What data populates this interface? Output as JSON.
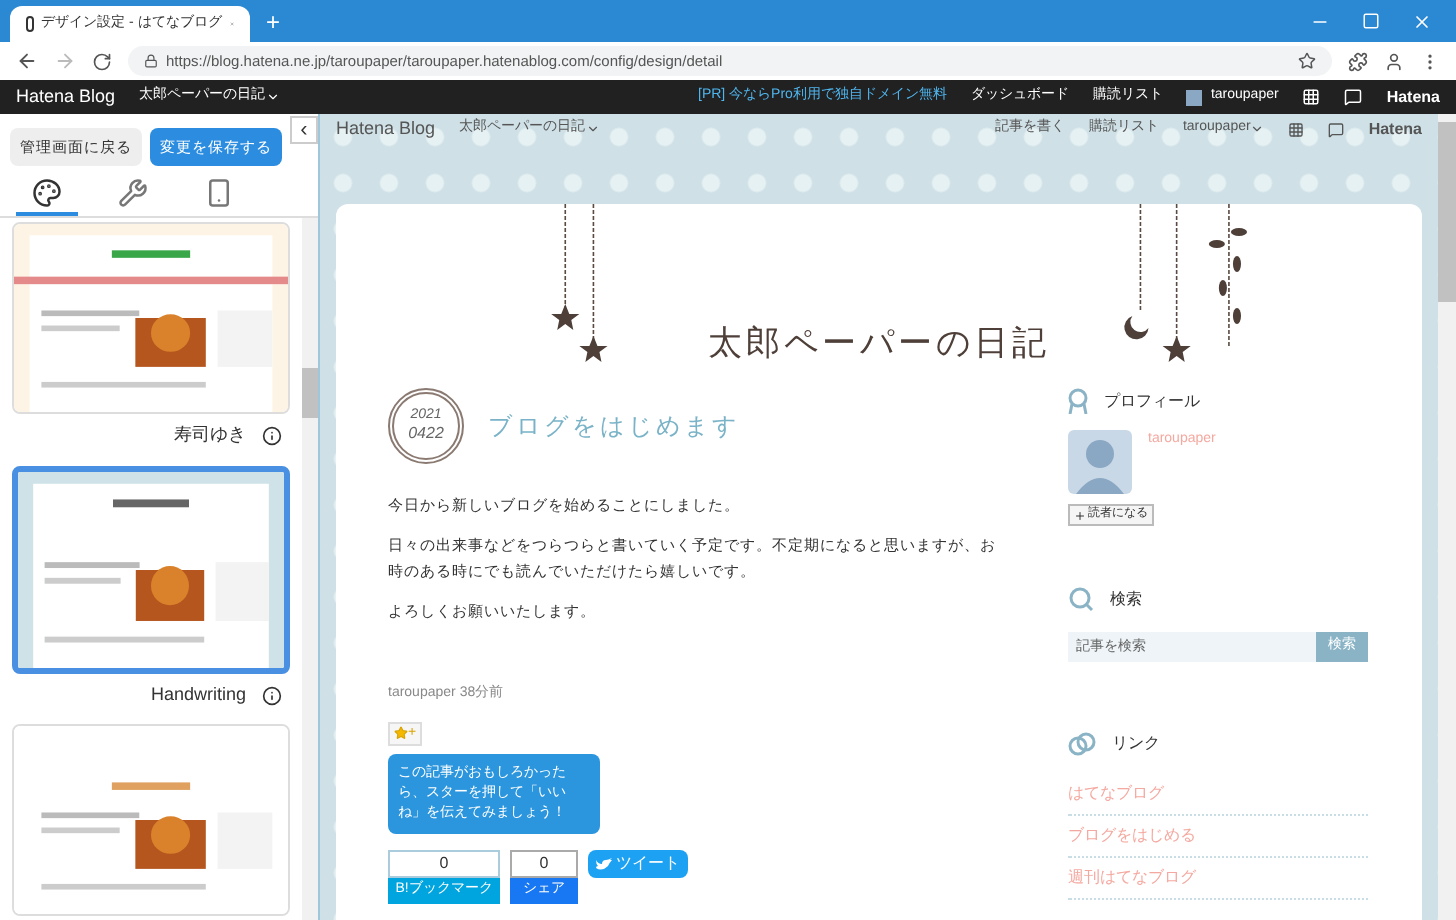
{
  "browser": {
    "tab_title": "デザイン設定 - はてなブログ",
    "new_tab": "+",
    "url": "https://blog.hatena.ne.jp/taroupaper/taroupaper.hatenablog.com/config/design/detail"
  },
  "hatena_bar": {
    "logo": "Hatena Blog",
    "blog_menu": "太郎ペーパーの日記",
    "promo": "[PR] 今ならPro利用で独自ドメイン無料",
    "dashboard": "ダッシュボード",
    "reading_list": "購読リスト",
    "user": "taroupaper",
    "brand": "Hatena"
  },
  "design_panel": {
    "back_button": "管理画面に戻る",
    "save_button": "変更を保存する",
    "collapse": "‹",
    "tabs": [
      {
        "kind": "theme",
        "selected": true
      },
      {
        "kind": "customize",
        "selected": false
      },
      {
        "kind": "smartphone",
        "selected": false
      }
    ],
    "themes": [
      {
        "name": "寿司ゆき",
        "selected": false
      },
      {
        "name": "Handwriting",
        "selected": true
      },
      {
        "selected": false
      }
    ]
  },
  "preview": {
    "bar": {
      "logo": "Hatena Blog",
      "blog_menu": "太郎ペーパーの日記",
      "write": "記事を書く",
      "reading_list": "購読リスト",
      "user": "taroupaper",
      "brand": "Hatena"
    },
    "blog_title": "太郎ペーパーの日記",
    "entry": {
      "date_year": "2021",
      "date_day": "0422",
      "title": "ブログをはじめます",
      "paragraphs": [
        "今日から新しいブログを始めることにしました。",
        "日々の出来事などをつらつらと書いていく予定です。不定期になると思いますが、お時のある時にでも読んでいただけたら嬉しいです。",
        "よろしくお願いいたします。"
      ],
      "author": "taroupaper",
      "time": "38分前",
      "star_button": "+",
      "tooltip": "この記事がおもしろかったら、スターを押して「いいね」を伝えてみましょう！",
      "share": [
        {
          "kind": "hatena",
          "count": "0",
          "label": "B!ブックマーク"
        },
        {
          "kind": "facebook",
          "count": "0",
          "label": "シェア"
        },
        {
          "kind": "twitter",
          "label": "ツイート"
        }
      ]
    },
    "sidebar": {
      "profile_heading": "プロフィール",
      "profile_name": "taroupaper",
      "subscribe": "読者になる",
      "search_heading": "検索",
      "search_placeholder": "記事を検索",
      "search_button": "検索",
      "links_heading": "リンク",
      "links": [
        "はてなブログ",
        "ブログをはじめる",
        "週刊はてなブログ"
      ]
    }
  }
}
